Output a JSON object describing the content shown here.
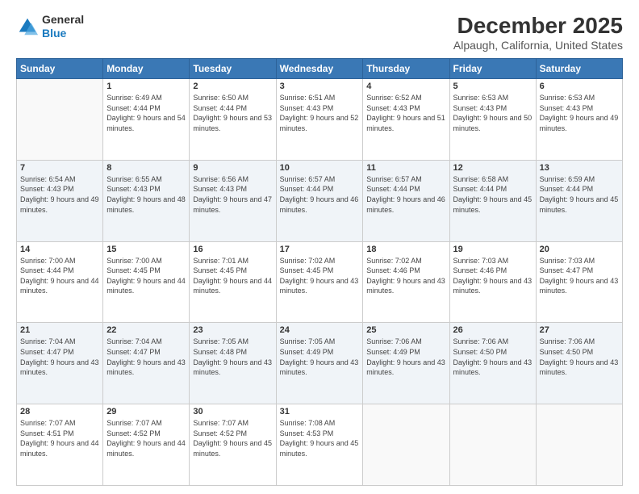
{
  "logo": {
    "line1": "General",
    "line2": "Blue"
  },
  "title": "December 2025",
  "subtitle": "Alpaugh, California, United States",
  "weekdays": [
    "Sunday",
    "Monday",
    "Tuesday",
    "Wednesday",
    "Thursday",
    "Friday",
    "Saturday"
  ],
  "weeks": [
    [
      {
        "day": "",
        "sunrise": "",
        "sunset": "",
        "daylight": ""
      },
      {
        "day": "1",
        "sunrise": "Sunrise: 6:49 AM",
        "sunset": "Sunset: 4:44 PM",
        "daylight": "Daylight: 9 hours and 54 minutes."
      },
      {
        "day": "2",
        "sunrise": "Sunrise: 6:50 AM",
        "sunset": "Sunset: 4:44 PM",
        "daylight": "Daylight: 9 hours and 53 minutes."
      },
      {
        "day": "3",
        "sunrise": "Sunrise: 6:51 AM",
        "sunset": "Sunset: 4:43 PM",
        "daylight": "Daylight: 9 hours and 52 minutes."
      },
      {
        "day": "4",
        "sunrise": "Sunrise: 6:52 AM",
        "sunset": "Sunset: 4:43 PM",
        "daylight": "Daylight: 9 hours and 51 minutes."
      },
      {
        "day": "5",
        "sunrise": "Sunrise: 6:53 AM",
        "sunset": "Sunset: 4:43 PM",
        "daylight": "Daylight: 9 hours and 50 minutes."
      },
      {
        "day": "6",
        "sunrise": "Sunrise: 6:53 AM",
        "sunset": "Sunset: 4:43 PM",
        "daylight": "Daylight: 9 hours and 49 minutes."
      }
    ],
    [
      {
        "day": "7",
        "sunrise": "Sunrise: 6:54 AM",
        "sunset": "Sunset: 4:43 PM",
        "daylight": "Daylight: 9 hours and 49 minutes."
      },
      {
        "day": "8",
        "sunrise": "Sunrise: 6:55 AM",
        "sunset": "Sunset: 4:43 PM",
        "daylight": "Daylight: 9 hours and 48 minutes."
      },
      {
        "day": "9",
        "sunrise": "Sunrise: 6:56 AM",
        "sunset": "Sunset: 4:43 PM",
        "daylight": "Daylight: 9 hours and 47 minutes."
      },
      {
        "day": "10",
        "sunrise": "Sunrise: 6:57 AM",
        "sunset": "Sunset: 4:44 PM",
        "daylight": "Daylight: 9 hours and 46 minutes."
      },
      {
        "day": "11",
        "sunrise": "Sunrise: 6:57 AM",
        "sunset": "Sunset: 4:44 PM",
        "daylight": "Daylight: 9 hours and 46 minutes."
      },
      {
        "day": "12",
        "sunrise": "Sunrise: 6:58 AM",
        "sunset": "Sunset: 4:44 PM",
        "daylight": "Daylight: 9 hours and 45 minutes."
      },
      {
        "day": "13",
        "sunrise": "Sunrise: 6:59 AM",
        "sunset": "Sunset: 4:44 PM",
        "daylight": "Daylight: 9 hours and 45 minutes."
      }
    ],
    [
      {
        "day": "14",
        "sunrise": "Sunrise: 7:00 AM",
        "sunset": "Sunset: 4:44 PM",
        "daylight": "Daylight: 9 hours and 44 minutes."
      },
      {
        "day": "15",
        "sunrise": "Sunrise: 7:00 AM",
        "sunset": "Sunset: 4:45 PM",
        "daylight": "Daylight: 9 hours and 44 minutes."
      },
      {
        "day": "16",
        "sunrise": "Sunrise: 7:01 AM",
        "sunset": "Sunset: 4:45 PM",
        "daylight": "Daylight: 9 hours and 44 minutes."
      },
      {
        "day": "17",
        "sunrise": "Sunrise: 7:02 AM",
        "sunset": "Sunset: 4:45 PM",
        "daylight": "Daylight: 9 hours and 43 minutes."
      },
      {
        "day": "18",
        "sunrise": "Sunrise: 7:02 AM",
        "sunset": "Sunset: 4:46 PM",
        "daylight": "Daylight: 9 hours and 43 minutes."
      },
      {
        "day": "19",
        "sunrise": "Sunrise: 7:03 AM",
        "sunset": "Sunset: 4:46 PM",
        "daylight": "Daylight: 9 hours and 43 minutes."
      },
      {
        "day": "20",
        "sunrise": "Sunrise: 7:03 AM",
        "sunset": "Sunset: 4:47 PM",
        "daylight": "Daylight: 9 hours and 43 minutes."
      }
    ],
    [
      {
        "day": "21",
        "sunrise": "Sunrise: 7:04 AM",
        "sunset": "Sunset: 4:47 PM",
        "daylight": "Daylight: 9 hours and 43 minutes."
      },
      {
        "day": "22",
        "sunrise": "Sunrise: 7:04 AM",
        "sunset": "Sunset: 4:47 PM",
        "daylight": "Daylight: 9 hours and 43 minutes."
      },
      {
        "day": "23",
        "sunrise": "Sunrise: 7:05 AM",
        "sunset": "Sunset: 4:48 PM",
        "daylight": "Daylight: 9 hours and 43 minutes."
      },
      {
        "day": "24",
        "sunrise": "Sunrise: 7:05 AM",
        "sunset": "Sunset: 4:49 PM",
        "daylight": "Daylight: 9 hours and 43 minutes."
      },
      {
        "day": "25",
        "sunrise": "Sunrise: 7:06 AM",
        "sunset": "Sunset: 4:49 PM",
        "daylight": "Daylight: 9 hours and 43 minutes."
      },
      {
        "day": "26",
        "sunrise": "Sunrise: 7:06 AM",
        "sunset": "Sunset: 4:50 PM",
        "daylight": "Daylight: 9 hours and 43 minutes."
      },
      {
        "day": "27",
        "sunrise": "Sunrise: 7:06 AM",
        "sunset": "Sunset: 4:50 PM",
        "daylight": "Daylight: 9 hours and 43 minutes."
      }
    ],
    [
      {
        "day": "28",
        "sunrise": "Sunrise: 7:07 AM",
        "sunset": "Sunset: 4:51 PM",
        "daylight": "Daylight: 9 hours and 44 minutes."
      },
      {
        "day": "29",
        "sunrise": "Sunrise: 7:07 AM",
        "sunset": "Sunset: 4:52 PM",
        "daylight": "Daylight: 9 hours and 44 minutes."
      },
      {
        "day": "30",
        "sunrise": "Sunrise: 7:07 AM",
        "sunset": "Sunset: 4:52 PM",
        "daylight": "Daylight: 9 hours and 45 minutes."
      },
      {
        "day": "31",
        "sunrise": "Sunrise: 7:08 AM",
        "sunset": "Sunset: 4:53 PM",
        "daylight": "Daylight: 9 hours and 45 minutes."
      },
      {
        "day": "",
        "sunrise": "",
        "sunset": "",
        "daylight": ""
      },
      {
        "day": "",
        "sunrise": "",
        "sunset": "",
        "daylight": ""
      },
      {
        "day": "",
        "sunrise": "",
        "sunset": "",
        "daylight": ""
      }
    ]
  ]
}
